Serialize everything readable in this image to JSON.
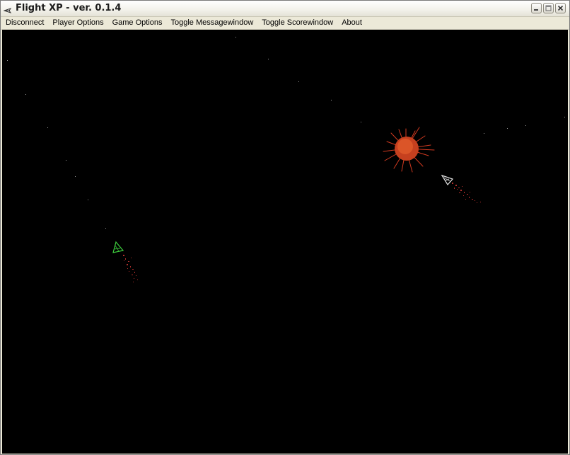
{
  "window": {
    "title": "Flight XP - ver. 0.1.4",
    "icon": "plane-icon"
  },
  "controls": {
    "minimize_icon": "minimize-icon",
    "maximize_icon": "maximize-icon",
    "close_icon": "close-icon"
  },
  "menu": {
    "items": [
      {
        "label": "Disconnect"
      },
      {
        "label": "Player Options"
      },
      {
        "label": "Game Options"
      },
      {
        "label": "Toggle Messagewindow"
      },
      {
        "label": "Toggle Scorewindow"
      },
      {
        "label": "About"
      }
    ]
  },
  "game": {
    "background": "#000000",
    "player_ship_color": "#3ecf3e",
    "enemy_ship_color": "#e0e0e0",
    "exhaust_color": "#c0302a",
    "explosion_color": "#e04a22"
  }
}
